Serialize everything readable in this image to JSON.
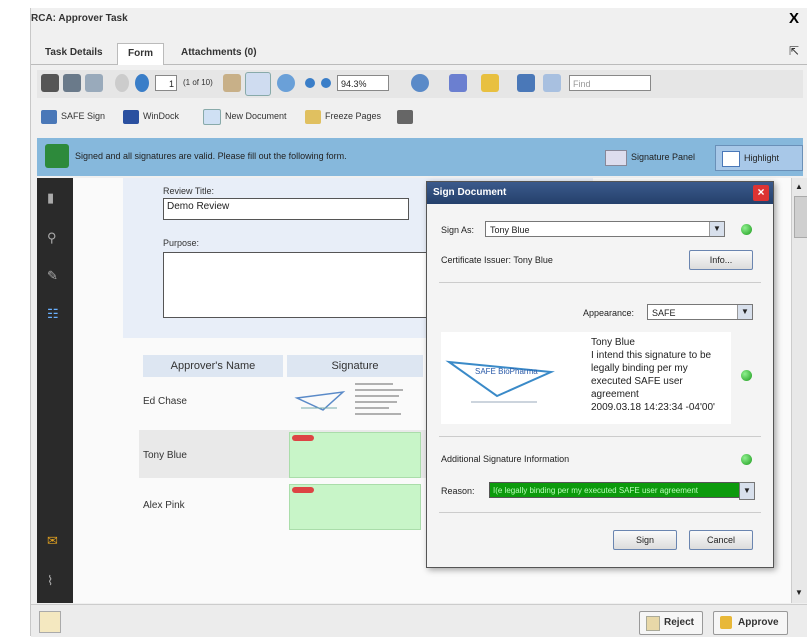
{
  "window": {
    "title": "RCA: Approver Task",
    "close_glyph": "X"
  },
  "tabs": [
    {
      "label": "Task Details"
    },
    {
      "label": "Form"
    },
    {
      "label": "Attachments (0)"
    }
  ],
  "toolbar": {
    "page_number": "1",
    "page_count": "(1 of 10)",
    "zoom": "94.3%",
    "find_placeholder": "Find"
  },
  "toolbar2": {
    "items": [
      "SAFE Sign",
      "WinDock",
      "New Document",
      "Freeze Pages"
    ]
  },
  "infobar": {
    "message": "Signed and all signatures are valid. Please fill out the following form.",
    "signature_panel": "Signature Panel",
    "highlight_fields": "Highlight Fields"
  },
  "form": {
    "review_title_label": "Review Title:",
    "review_title_value": "Demo Review",
    "purpose_label": "Purpose:",
    "purpose_value": ""
  },
  "approvers_table": {
    "headers": [
      "Approver's Name",
      "Signature"
    ],
    "rows": [
      {
        "name": "Ed Chase"
      },
      {
        "name": "Tony Blue"
      },
      {
        "name": "Alex Pink"
      }
    ]
  },
  "dialog": {
    "title": "Sign Document",
    "sign_as_label": "Sign As:",
    "sign_as_value": "Tony Blue",
    "cert_issuer": "Certificate Issuer: Tony Blue",
    "info_button": "Info...",
    "appearance_label": "Appearance:",
    "appearance_value": "SAFE",
    "preview_logo": "SAFE BioPharma",
    "preview_text": "Tony Blue\nI intend this signature to be legally binding per my executed SAFE user agreement\n2009.03.18 14:23:34 -04'00'",
    "additional_info_label": "Additional Signature Information",
    "reason_label": "Reason:",
    "reason_value": "I(e legally binding per my executed SAFE user agreement",
    "sign_button": "Sign",
    "cancel_button": "Cancel"
  },
  "bottom": {
    "reject": "Reject",
    "approve": "Approve"
  },
  "colors": {
    "infobar": "#86b8dc",
    "signature_field": "#c8f5c8",
    "dialog_title": "#2f4d7e",
    "valid_dot": "#1c9a1c",
    "reason_bg": "#0c9a0c"
  }
}
